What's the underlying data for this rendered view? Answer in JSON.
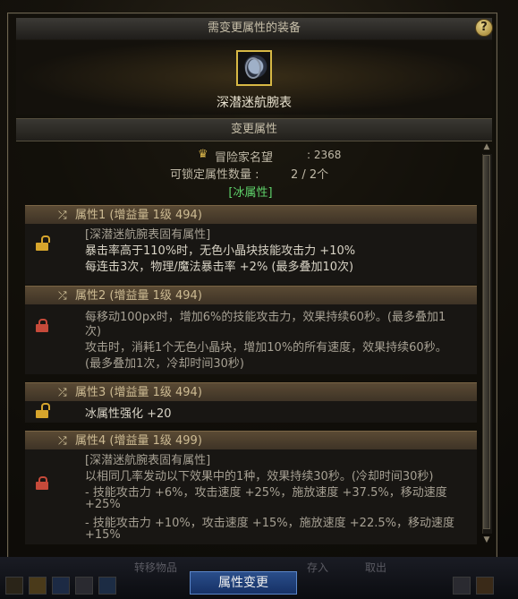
{
  "dialog": {
    "title": "需变更属性的装备",
    "help_label": "?",
    "equip_name": "深潜迷航腕表",
    "section_title": "变更属性",
    "fame_label": "冒险家名望",
    "fame_value": ": 2368",
    "lock_label": "可锁定属性数量 :",
    "lock_value": "2 / 2个",
    "element_tag": "[冰属性]"
  },
  "attributes": [
    {
      "header": "属性1 (增益量 1级 494)",
      "lock": "unlocked",
      "lines": [
        {
          "text": "[深潜迷航腕表固有属性]",
          "style": "gray"
        },
        {
          "text": "暴击率高于110%时，无色小晶块技能攻击力 +10%",
          "style": "normal"
        },
        {
          "text": "每连击3次，物理/魔法暴击率 +2% (最多叠加10次)",
          "style": "normal"
        }
      ]
    },
    {
      "header": "属性2 (增益量 1级 494)",
      "lock": "locked",
      "lines": [
        {
          "text": "每移动100px时，增加6%的技能攻击力，效果持续60秒。(最多叠加1",
          "style": "gray"
        },
        {
          "text": "次)",
          "style": "gray"
        },
        {
          "text": "攻击时，消耗1个无色小晶块，增加10%的所有速度，效果持续60秒。",
          "style": "gray"
        },
        {
          "text": "(最多叠加1次，冷却时间30秒)",
          "style": "gray"
        }
      ]
    },
    {
      "header": "属性3 (增益量 1级 494)",
      "lock": "unlocked",
      "lines": [
        {
          "text": "冰属性强化 +20",
          "style": "normal"
        }
      ]
    },
    {
      "header": "属性4 (增益量 1级 499)",
      "lock": "locked",
      "lines": [
        {
          "text": "[深潜迷航腕表固有属性]",
          "style": "gray"
        },
        {
          "text": "以相同几率发动以下效果中的1种，效果持续30秒。(冷却时间30秒)",
          "style": "gray"
        },
        {
          "text": "- 技能攻击力 +6%，攻击速度 +25%，施放速度 +37.5%，移动速度",
          "style": "gray"
        },
        {
          "text": "+25%",
          "style": "gray"
        },
        {
          "text": "- 技能攻击力 +10%，攻击速度 +15%，施放速度 +22.5%，移动速度",
          "style": "gray"
        },
        {
          "text": "+15%",
          "style": "gray"
        }
      ]
    }
  ],
  "footer": {
    "left_label": "转移物品",
    "mid_label": "存入",
    "right_label": "取出",
    "apply_button": "属性变更"
  },
  "colors": {
    "element_green": "#5fd36b",
    "unlocked": "#d6a52c",
    "locked": "#c64a3a",
    "apply_blue": "#1f3f78"
  }
}
